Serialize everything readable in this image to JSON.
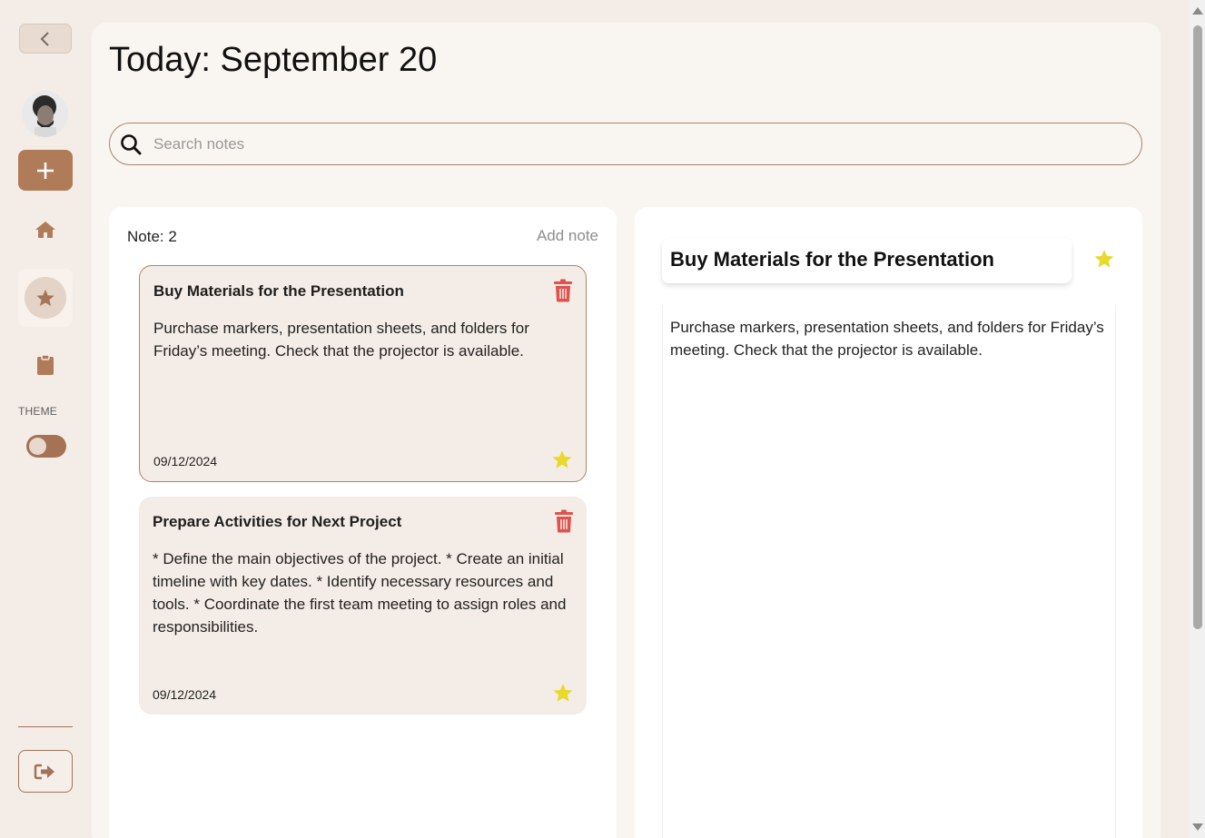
{
  "header": {
    "title": "Today: September 20"
  },
  "search": {
    "placeholder": "Search notes"
  },
  "sidebar": {
    "back_icon": "chevron-left-icon",
    "add_icon": "plus-icon",
    "nav": [
      "home-icon",
      "star-icon",
      "clipboard-icon"
    ],
    "theme_label": "THEME",
    "logout_icon": "logout-icon"
  },
  "notes_list": {
    "count_label": "Note: 2",
    "add_label": "Add note",
    "notes": [
      {
        "title": "Buy Materials for the Presentation",
        "body": "Purchase markers, presentation sheets, and folders for Friday’s meeting. Check that the projector is available.",
        "date": "09/12/2024"
      },
      {
        "title": "Prepare Activities for Next Project",
        "body": "* Define the main objectives of the project. * Create an initial timeline with key dates. * Identify necessary resources and tools. * Coordinate the first team meeting to assign roles and responsibilities.",
        "date": "09/12/2024"
      }
    ]
  },
  "detail": {
    "title": "Buy Materials for the Presentation",
    "body": "Purchase markers, presentation sheets, and folders for Friday’s meeting. Check that the projector is available."
  },
  "colors": {
    "accent": "#b07b58",
    "background": "#f4ede7",
    "star": "#e8d92c",
    "trash": "#e0524b"
  }
}
